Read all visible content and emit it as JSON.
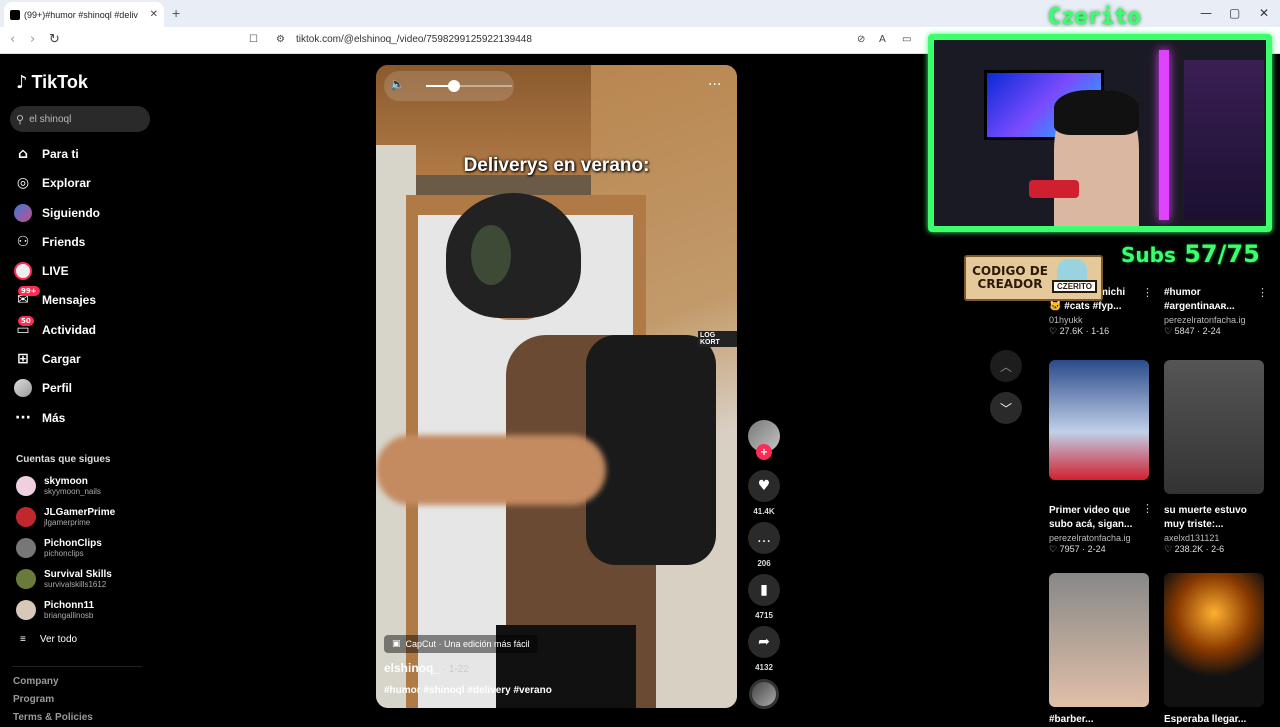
{
  "browser": {
    "tab_title": "(99+)#humor #shinoql #deliv",
    "tab_close": "✕",
    "new_tab": "+",
    "url": "tiktok.com/@elshinoq_/video/7598299125922139448",
    "win_min": "—",
    "win_max": "▢",
    "win_close": "✕"
  },
  "sidebar": {
    "logo": "TikTok",
    "search_value": "el shinoql",
    "nav": [
      {
        "label": "Para ti",
        "icon": "home-icon",
        "glyph": "⌂"
      },
      {
        "label": "Explorar",
        "icon": "compass-icon",
        "glyph": "◎"
      },
      {
        "label": "Siguiendo",
        "icon": "following-avatar-icon",
        "glyph": ""
      },
      {
        "label": "Friends",
        "icon": "friends-icon",
        "glyph": "👥"
      },
      {
        "label": "LIVE",
        "icon": "live-avatar-icon",
        "glyph": ""
      },
      {
        "label": "Mensajes",
        "icon": "messages-icon",
        "glyph": "✉",
        "badge": "99+"
      },
      {
        "label": "Actividad",
        "icon": "activity-icon",
        "glyph": "▭",
        "badge": "50"
      },
      {
        "label": "Cargar",
        "icon": "upload-icon",
        "glyph": "⊞"
      },
      {
        "label": "Perfil",
        "icon": "profile-avatar-icon",
        "glyph": ""
      },
      {
        "label": "Más",
        "icon": "more-icon",
        "glyph": "···"
      }
    ],
    "following_title": "Cuentas que sigues",
    "accounts": [
      {
        "name": "skymoon",
        "handle": "skyymoon_nails"
      },
      {
        "name": "JLGamerPrime",
        "handle": "jlgamerprime"
      },
      {
        "name": "PichonClips",
        "handle": "pichonclips"
      },
      {
        "name": "Survival Skills",
        "handle": "survivalskills1612"
      },
      {
        "name": "Pichonn11",
        "handle": "briangallinosb"
      }
    ],
    "see_all": "Ver todo",
    "see_all_icon": "≡",
    "footer": [
      "Company",
      "Program",
      "Terms & Policies"
    ]
  },
  "video": {
    "caption_overlay": "Deliverys en verano:",
    "capcut_label": "CapCut · Una edición más fácil",
    "author": "elshinoq_",
    "date": " · 1-22",
    "hashtags": "#humor #shinoql #delivery #verano",
    "watermark": "LOG KORT",
    "volume_fraction": 0.3,
    "volume_icon": "🔈",
    "more_icon": "···"
  },
  "actions": {
    "follow_plus": "+",
    "likes": "41.4K",
    "comments": "206",
    "saves": "4715",
    "shares": "4132",
    "like_icon": "♥",
    "comment_icon": "…",
    "save_icon": "▮",
    "share_icon": "➦"
  },
  "scroll": {
    "up": "︿",
    "down": "﹀"
  },
  "related": [
    {
      "title": "🐱 #cats #fyp...",
      "title_pre": "michi",
      "author": "01hyukk",
      "stats": "♡ 27.6K · 1-16"
    },
    {
      "title": "#argentinaᴀʀ...",
      "title_pre": "#humor",
      "author": "perezelratonfacha.ig",
      "stats": "♡ 5847 · 2-24"
    },
    {
      "title": "Primer video que",
      "title2": "subo acá, sigan...",
      "author": "perezelratonfacha.ig",
      "stats": "♡ 7957 · 2-24"
    },
    {
      "title": "su muerte estuvo",
      "title2": "muy triste:...",
      "author": "axelxd131121",
      "stats": "♡ 238.2K · 2-6"
    },
    {
      "title": "#barber...",
      "author": "",
      "stats": ""
    },
    {
      "title": "Esperaba llegar...",
      "author": "",
      "stats": ""
    }
  ],
  "overlay": {
    "streamer": "Czerito",
    "subs_label": "Subs",
    "subs_value": "57/75",
    "code_text": "CODIGO DE CREADOR",
    "code_name": "CZERITO"
  }
}
